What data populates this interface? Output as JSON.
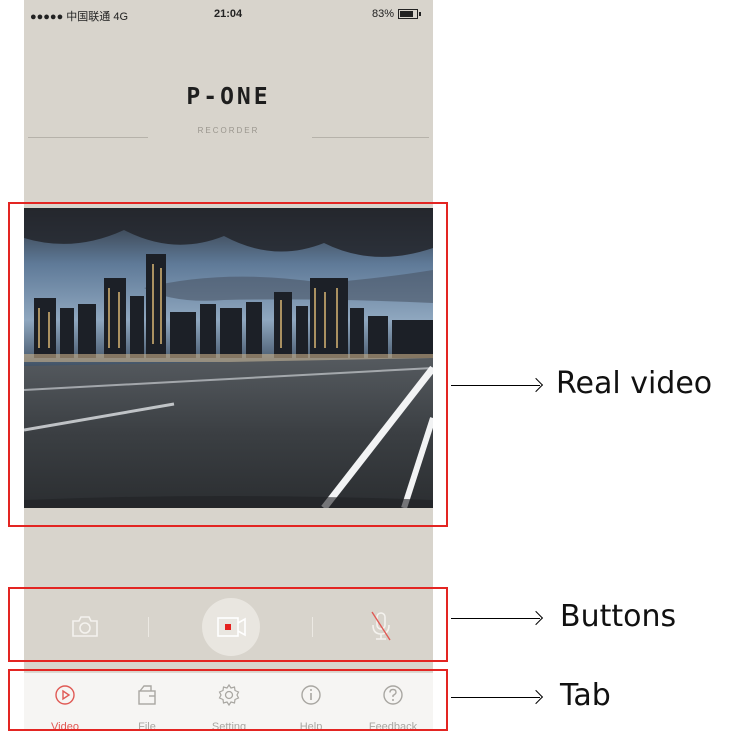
{
  "status_bar": {
    "carrier": "●●●●● 中国联通  4G",
    "time": "21:04",
    "battery": "83%"
  },
  "brand": {
    "logo": "P-ONE",
    "subtitle": "RECORDER"
  },
  "controls": {
    "camera_icon": "camera-icon",
    "record_icon": "video-record-icon",
    "mic_icon": "mic-muted-icon",
    "accent": "#e5221f"
  },
  "tabs": [
    {
      "label": "Video",
      "icon": "play-circle-icon",
      "active": true
    },
    {
      "label": "File",
      "icon": "folder-icon",
      "active": false
    },
    {
      "label": "Setting",
      "icon": "gear-icon",
      "active": false
    },
    {
      "label": "Help",
      "icon": "info-icon",
      "active": false
    },
    {
      "label": "Feedback",
      "icon": "question-icon",
      "active": false
    }
  ],
  "annotations": {
    "video": "Real video",
    "buttons": "Buttons",
    "tab": "Tab",
    "color": "#e32522"
  }
}
